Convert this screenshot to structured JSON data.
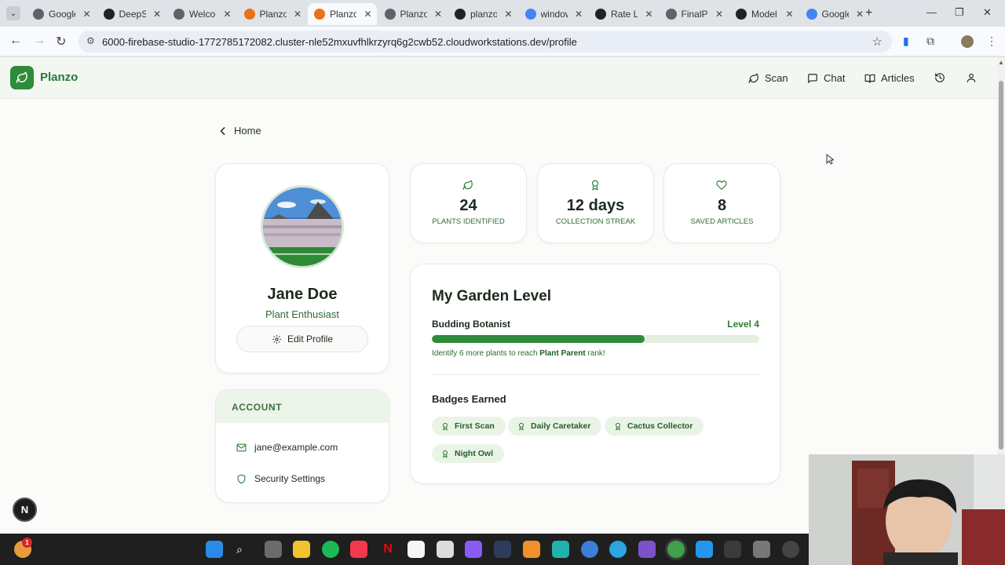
{
  "browser": {
    "tabs": [
      {
        "title": "Google",
        "color": "#5f6368"
      },
      {
        "title": "DeepSeek",
        "color": "#222222"
      },
      {
        "title": "Welcome",
        "color": "#5f6368"
      },
      {
        "title": "Planzo",
        "color": "#e8711a"
      },
      {
        "title": "Planzo",
        "color": "#e8711a",
        "active": true
      },
      {
        "title": "Planzo",
        "color": "#5f6368"
      },
      {
        "title": "planzo",
        "color": "#222222"
      },
      {
        "title": "window",
        "color": "#4285f4"
      },
      {
        "title": "Rate Limit",
        "color": "#222222"
      },
      {
        "title": "FinalP",
        "color": "#5f6368"
      },
      {
        "title": "Model",
        "color": "#222222"
      },
      {
        "title": "Google",
        "color": "#4285f4"
      }
    ],
    "url": "6000-firebase-studio-1772785172082.cluster-nle52mxuvfhlkrzyrq6g2cwb52.cloudworkstations.dev/profile"
  },
  "app": {
    "brand": "Planzo",
    "nav": {
      "scan": "Scan",
      "chat": "Chat",
      "articles": "Articles"
    }
  },
  "breadcrumb": {
    "back_label": "Home"
  },
  "profile": {
    "name": "Jane Doe",
    "role": "Plant Enthusiast",
    "edit_label": "Edit Profile"
  },
  "account": {
    "heading": "ACCOUNT",
    "email": "jane@example.com",
    "security_label": "Security Settings"
  },
  "stats": [
    {
      "value": "24",
      "label": "PLANTS IDENTIFIED",
      "icon": "leaf-icon"
    },
    {
      "value": "12 days",
      "label": "COLLECTION STREAK",
      "icon": "award-icon"
    },
    {
      "value": "8",
      "label": "SAVED ARTICLES",
      "icon": "heart-icon"
    }
  ],
  "garden": {
    "title": "My Garden Level",
    "rank": "Budding Botanist",
    "level": "Level 4",
    "progress": 0.65,
    "hint_prefix": "Identify 6 more plants to reach ",
    "hint_target": "Plant Parent",
    "hint_suffix": " rank!",
    "badges_title": "Badges Earned",
    "badges": [
      "First Scan",
      "Daily Caretaker",
      "Cactus Collector",
      "Night Owl"
    ]
  },
  "colors": {
    "brand": "#2e8b3a",
    "accent_text": "#2f6b35",
    "badge_bg": "#e9f3e6"
  },
  "dev_indicator": "N",
  "taskbar": {
    "notification_count": "1"
  }
}
